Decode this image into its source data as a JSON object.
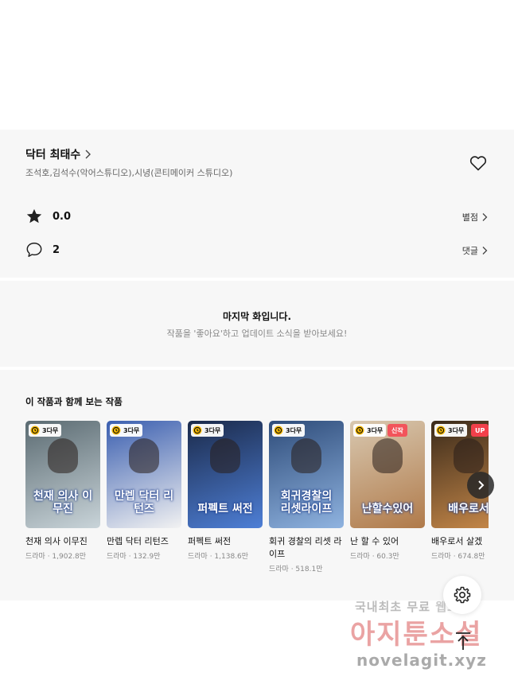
{
  "work": {
    "title": "닥터 최태수",
    "authors": "조석호,김석수(악어스튜디오),시녕(콘티메이커 스튜디오)"
  },
  "stats": {
    "rating": "0.0",
    "rating_link": "별점",
    "comments": "2",
    "comments_link": "댓글"
  },
  "last_episode": {
    "title": "마지막 화입니다.",
    "subtitle": "작품을 '좋아요'하고 업데이트 소식을 받아보세요!"
  },
  "recommendations": {
    "heading": "이 작품과 함께 보는 작품",
    "items": [
      {
        "title": "천재 의사 이무진",
        "genre_views": "드라마 · 1,902.8만",
        "badge": "3다무",
        "tag": "",
        "colors": [
          "#5b6b72",
          "#c9d4d9"
        ],
        "cover_text": "천재 의사 이무진"
      },
      {
        "title": "만렙 닥터 리턴즈",
        "genre_views": "드라마 · 132.9만",
        "badge": "3다무",
        "tag": "",
        "colors": [
          "#3b5fb0",
          "#f2f2f2"
        ],
        "cover_text": "만렙 닥터 리턴즈"
      },
      {
        "title": "퍼펙트 써전",
        "genre_views": "드라마 · 1,138.6만",
        "badge": "3다무",
        "tag": "",
        "colors": [
          "#1b2a4a",
          "#4e7fd6"
        ],
        "cover_text": "퍼펙트 써전"
      },
      {
        "title": "회귀 경찰의 리셋 라이프",
        "genre_views": "드라마 · 518.1만",
        "badge": "3다무",
        "tag": "",
        "colors": [
          "#2e4c7a",
          "#8fb3e0"
        ],
        "cover_text": "회귀경찰의 리셋라이프"
      },
      {
        "title": "난 할 수 있어",
        "genre_views": "드라마 · 60.3만",
        "badge": "3다무",
        "tag": "신작",
        "colors": [
          "#d8c8b0",
          "#b07a4a"
        ],
        "cover_text": "난할수있어"
      },
      {
        "title": "배우로서 살겠",
        "genre_views": "드라마 · 674.8만",
        "badge": "3다무",
        "tag": "UP",
        "colors": [
          "#3a2a1a",
          "#c98a4a"
        ],
        "cover_text": "배우로서"
      }
    ]
  },
  "tag_colors": {
    "신작": "#f2545b",
    "UP": "#f2404a"
  },
  "watermark": {
    "line1_a": "국내최초 무료",
    "line1_b": "웹소설",
    "line2": "아지툰소설",
    "line3": "novelagit.xyz"
  }
}
